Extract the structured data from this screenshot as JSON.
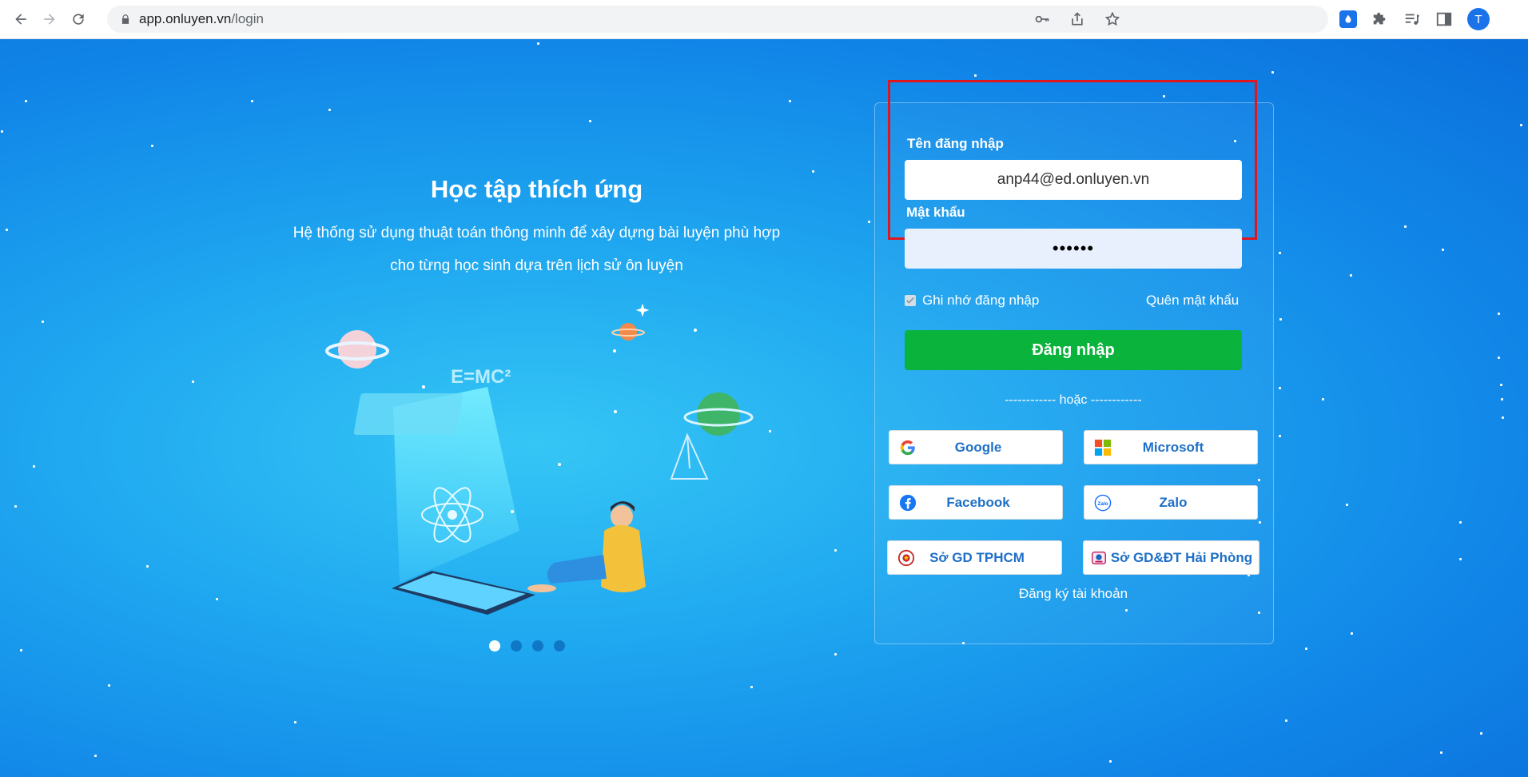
{
  "browser": {
    "url_domain": "app.onluyen.vn",
    "url_path": "/login",
    "avatar_letter": "T"
  },
  "hero": {
    "title": "Học tập thích ứng",
    "subtitle_line1": "Hệ thống sử dụng thuật toán thông minh để xây dựng bài luyện phù hợp",
    "subtitle_line2": "cho từng học sinh dựa trên lịch sử ôn luyện",
    "illustration_text": "E=MC²",
    "carousel_active_index": 0,
    "carousel_count": 4
  },
  "login": {
    "username_label": "Tên đăng nhập",
    "username_value": "anp44@ed.onluyen.vn",
    "password_label": "Mật khẩu",
    "password_value": "••••••",
    "remember_label": "Ghi nhớ đăng nhập",
    "remember_checked": true,
    "forgot_label": "Quên mật khẩu",
    "submit_label": "Đăng nhập",
    "or_label": "------------ hoặc ------------",
    "register_label": "Đăng ký tài khoản"
  },
  "sso": {
    "google": "Google",
    "microsoft": "Microsoft",
    "facebook": "Facebook",
    "zalo": "Zalo",
    "hcm": "Sở GD TPHCM",
    "haiphong": "Sở GD&ĐT Hải Phòng"
  },
  "colors": {
    "background": "#1a9cef",
    "login_button": "#0ab33c",
    "highlight_border": "#e0161f",
    "sso_text": "#1e6fc7"
  }
}
